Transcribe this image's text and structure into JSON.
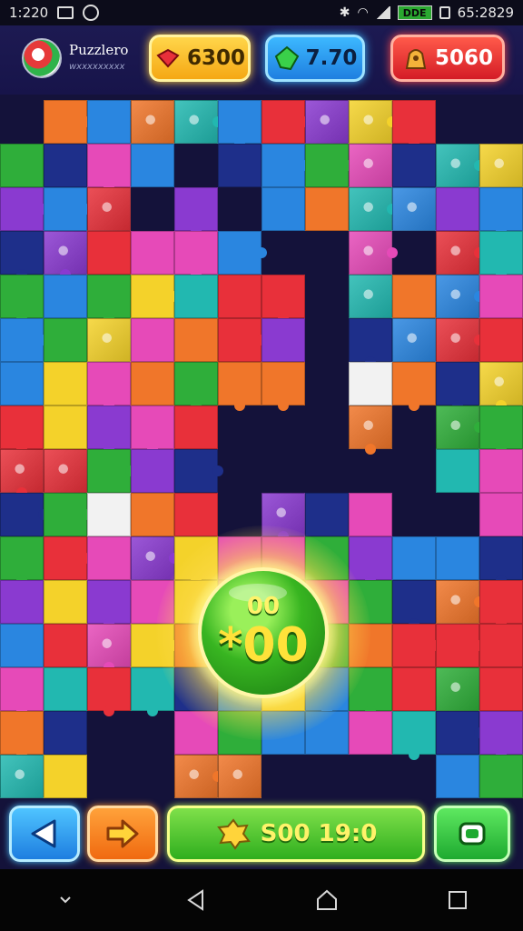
{
  "status_bar": {
    "time": "1:220",
    "clock": "65:2829",
    "battery": "DDE"
  },
  "header": {
    "app_title": "Puzzlero",
    "app_subtitle": "wxxxxxxxxx",
    "gold_label": "▸",
    "gold_value": "6300",
    "gems_value": "7.70",
    "bag_value": "5060"
  },
  "center": {
    "top_text": "00",
    "main_text": "*00"
  },
  "controls": {
    "status_text": "S00 19:0"
  },
  "colors": {
    "red": "#e8303a",
    "green": "#2fae3a",
    "blue": "#2a86e0",
    "pink": "#e64ab8",
    "orange": "#f0762a",
    "yellow": "#f4d22a",
    "purple": "#8a3ad0",
    "teal": "#22b8b0",
    "navy": "#1e2f8a",
    "white": "#f2f2f2",
    "board_bg": "#1c1b55"
  },
  "icons": [
    "back-arrow-icon",
    "next-arrow-icon",
    "star-burst-icon",
    "camera-icon",
    "gem-icon",
    "bag-icon",
    "heart-gem-icon"
  ]
}
